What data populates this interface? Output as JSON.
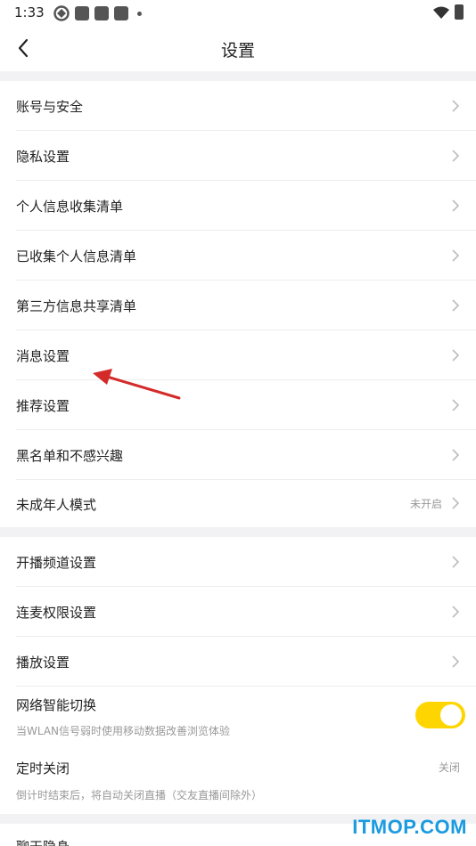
{
  "status_bar": {
    "time": "1:33"
  },
  "header": {
    "title": "设置"
  },
  "groups": [
    {
      "items": [
        {
          "label": "账号与安全"
        },
        {
          "label": "隐私设置"
        },
        {
          "label": "个人信息收集清单"
        },
        {
          "label": "已收集个人信息清单"
        },
        {
          "label": "第三方信息共享清单"
        },
        {
          "label": "消息设置"
        },
        {
          "label": "推荐设置"
        },
        {
          "label": "黑名单和不感兴趣"
        },
        {
          "label": "未成年人模式",
          "value": "未开启"
        }
      ]
    },
    {
      "items": [
        {
          "label": "开播频道设置"
        },
        {
          "label": "连麦权限设置"
        },
        {
          "label": "播放设置"
        },
        {
          "label": "网络智能切换",
          "sub": "当WLAN信号弱时使用移动数据改善浏览体验",
          "toggle_on": true
        },
        {
          "label": "定时关闭",
          "value": "关闭",
          "sub": "倒计时结束后，将自动关闭直播（交友直播间除外）"
        }
      ]
    },
    {
      "items": [
        {
          "label": "聊天隐身"
        }
      ]
    }
  ],
  "watermark": "ITMOP.COM",
  "colors": {
    "toggle_on": "#ffd500",
    "annotation_arrow": "#d42a2a",
    "watermark": "#1a9be0"
  },
  "icons": {
    "back": "chevron-left-icon",
    "row": "chevron-right-icon"
  }
}
